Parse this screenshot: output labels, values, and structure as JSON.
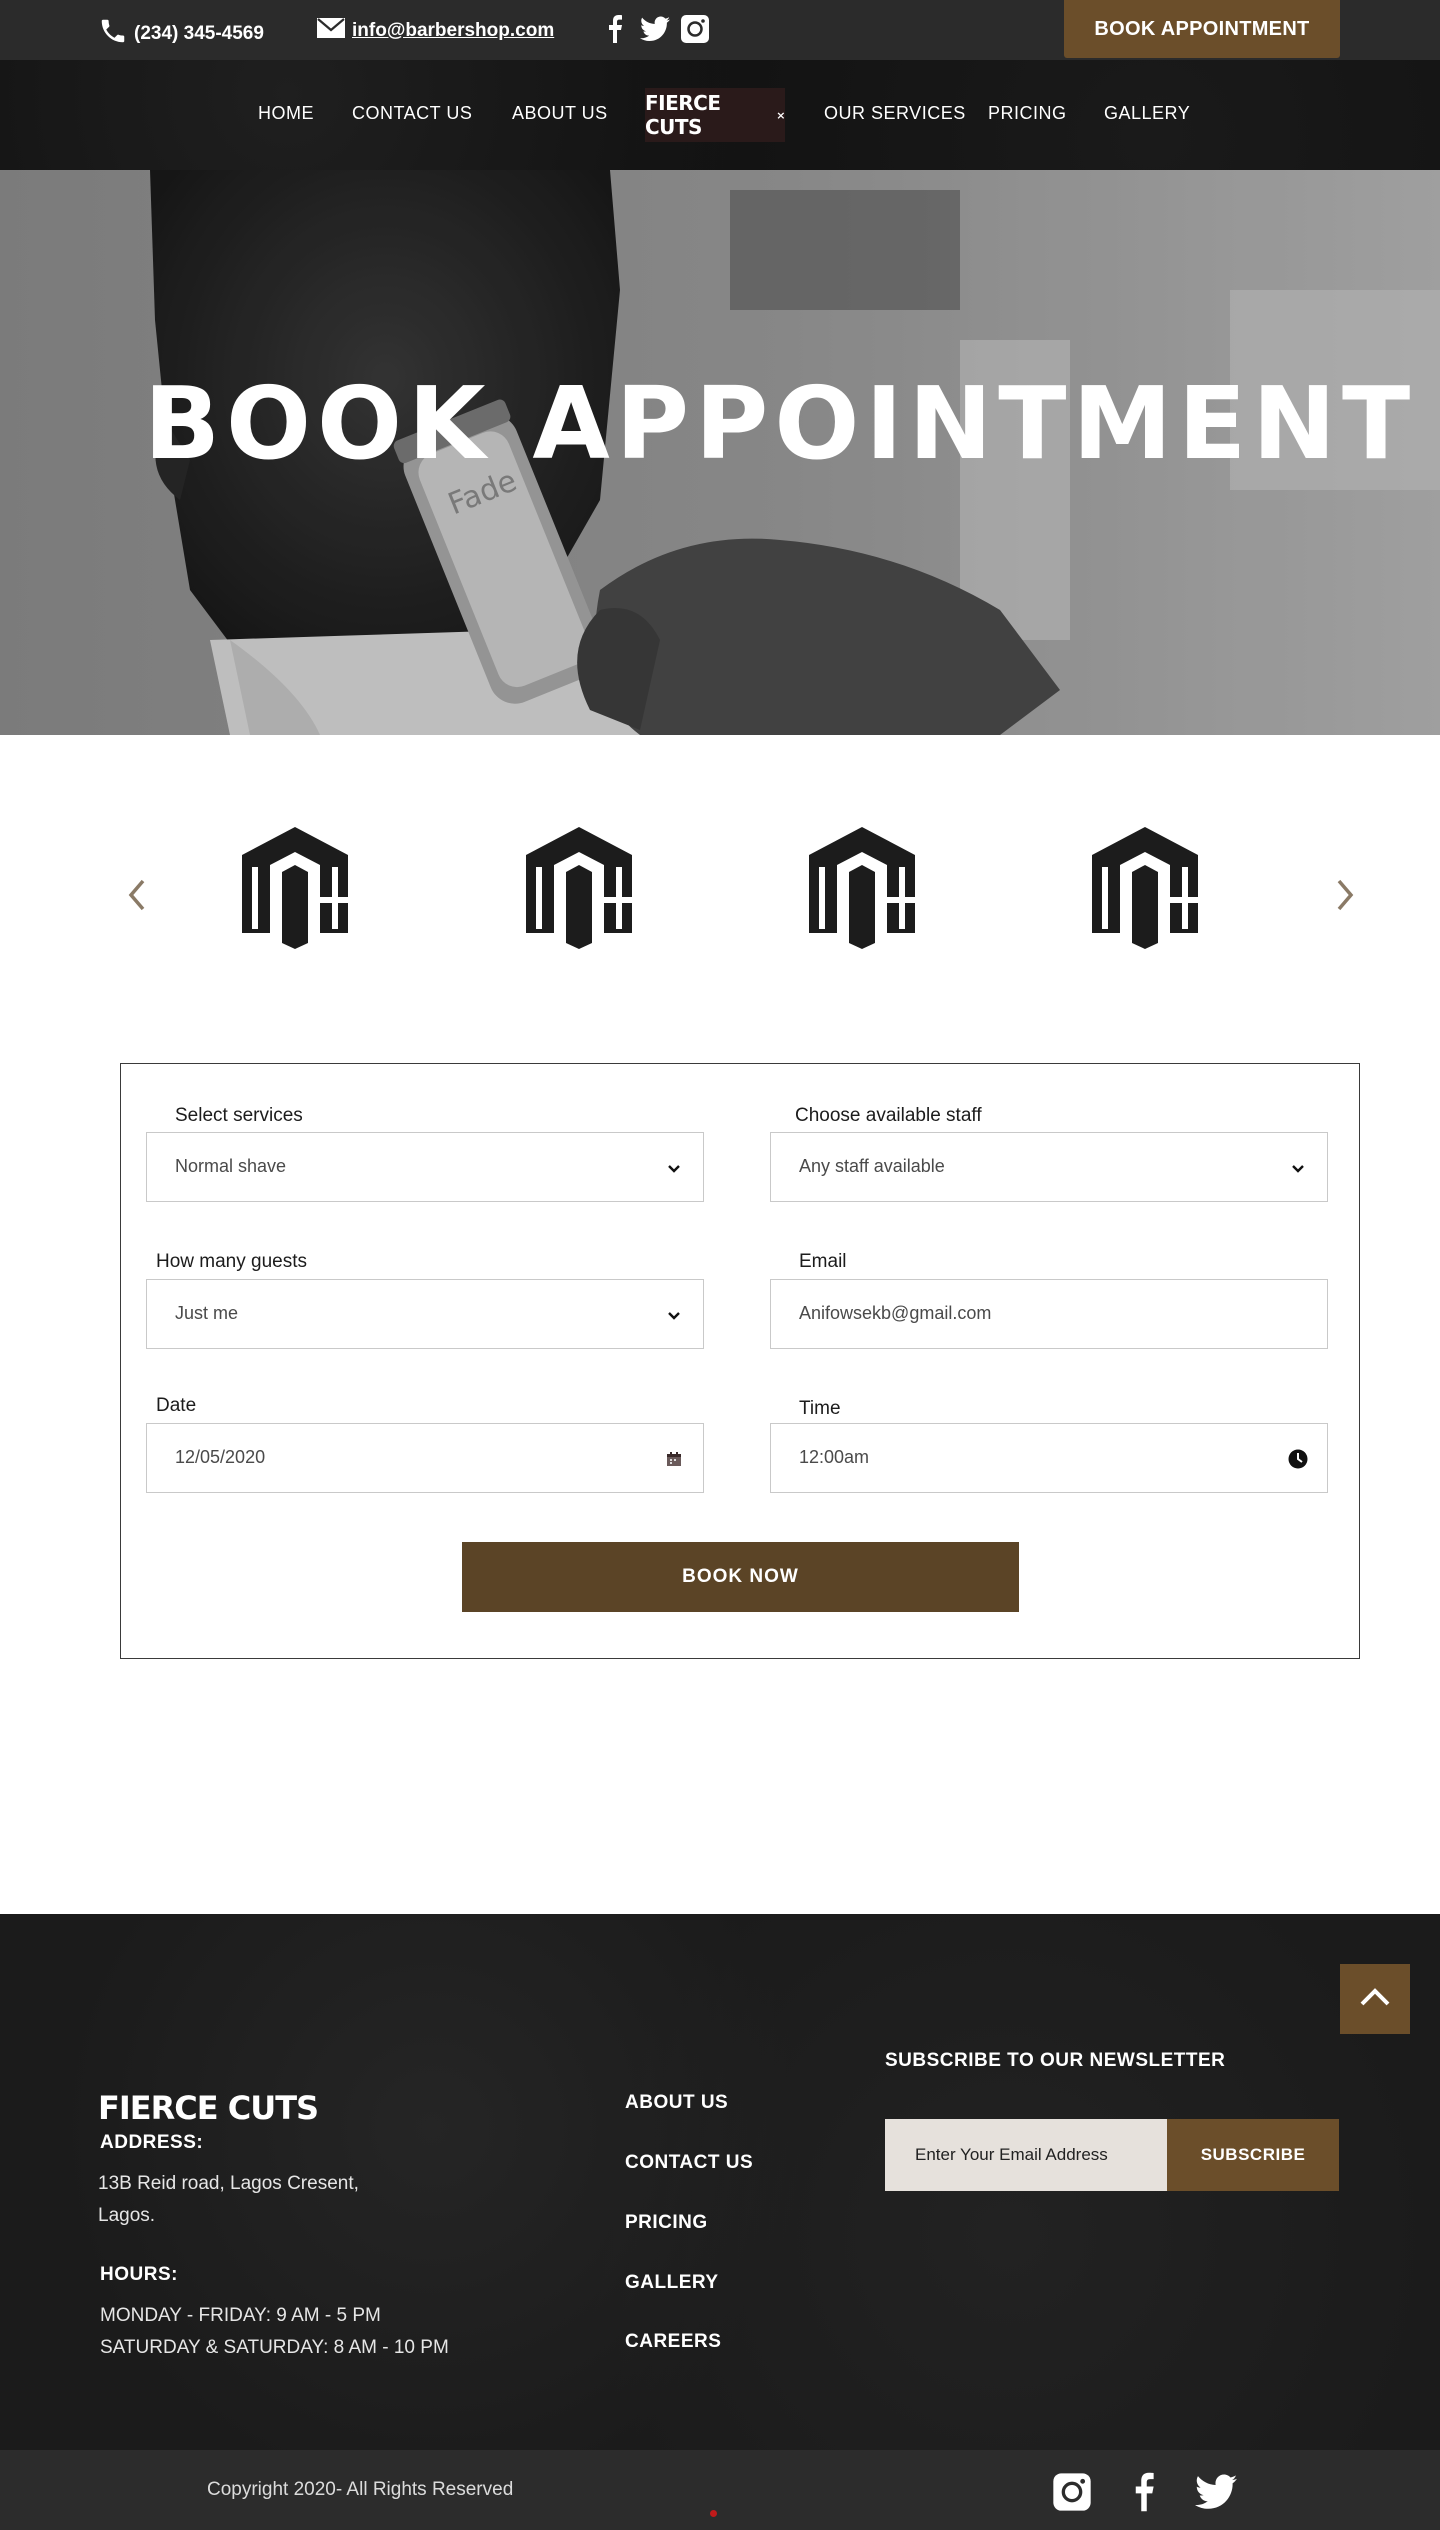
{
  "topbar": {
    "phone": "(234) 345-4569",
    "email": "info@barbershop.com",
    "socials": [
      "facebook-icon",
      "twitter-icon",
      "instagram-icon"
    ],
    "book_button": "BOOK APPOINTMENT"
  },
  "nav": {
    "items_left": [
      "HOME",
      "CONTACT US",
      "ABOUT US"
    ],
    "logo": "FIERCE CUTS",
    "logo_suffix": "×",
    "items_right": [
      "OUR SERVICES",
      "PRICING",
      "GALLERY"
    ]
  },
  "hero": {
    "title": "BOOK APPOINTMENT",
    "clipper_text": "Fade"
  },
  "carousel": {
    "prev": "chevron-left-icon",
    "next": "chevron-right-icon",
    "brand_count_visible": 4
  },
  "form": {
    "services": {
      "label": "Select services",
      "value": "Normal shave"
    },
    "staff": {
      "label": "Choose available staff",
      "value": "Any staff available"
    },
    "guests": {
      "label": "How many guests",
      "value": "Just me"
    },
    "email": {
      "label": "Email",
      "value": "Anifowsekb@gmail.com"
    },
    "date": {
      "label": "Date",
      "value": "12/05/2020"
    },
    "time": {
      "label": "Time",
      "value": "12:00am"
    },
    "submit": "BOOK NOW"
  },
  "footer": {
    "logo": "FIERCE CUTS",
    "address_heading": "ADDRESS:",
    "address_line1": "13B Reid road, Lagos Cresent,",
    "address_line2": "Lagos.",
    "hours_heading": "HOURS:",
    "hours_line1": "MONDAY - FRIDAY: 9 AM - 5 PM",
    "hours_line2": "SATURDAY & SATURDAY: 8 AM - 10 PM",
    "links": [
      "ABOUT US",
      "CONTACT US",
      "PRICING",
      "GALLERY",
      "CAREERS"
    ],
    "newsletter_heading": "SUBSCRIBE TO OUR NEWSLETTER",
    "newsletter_placeholder": "Enter Your Email Address",
    "subscribe_button": "SUBSCRIBE",
    "copyright": "Copyright 2020- All Rights Reserved"
  },
  "colors": {
    "accent_brown": "#6b4e2a",
    "button_brown": "#5b4426",
    "dark_bar": "#2b2b2b"
  }
}
